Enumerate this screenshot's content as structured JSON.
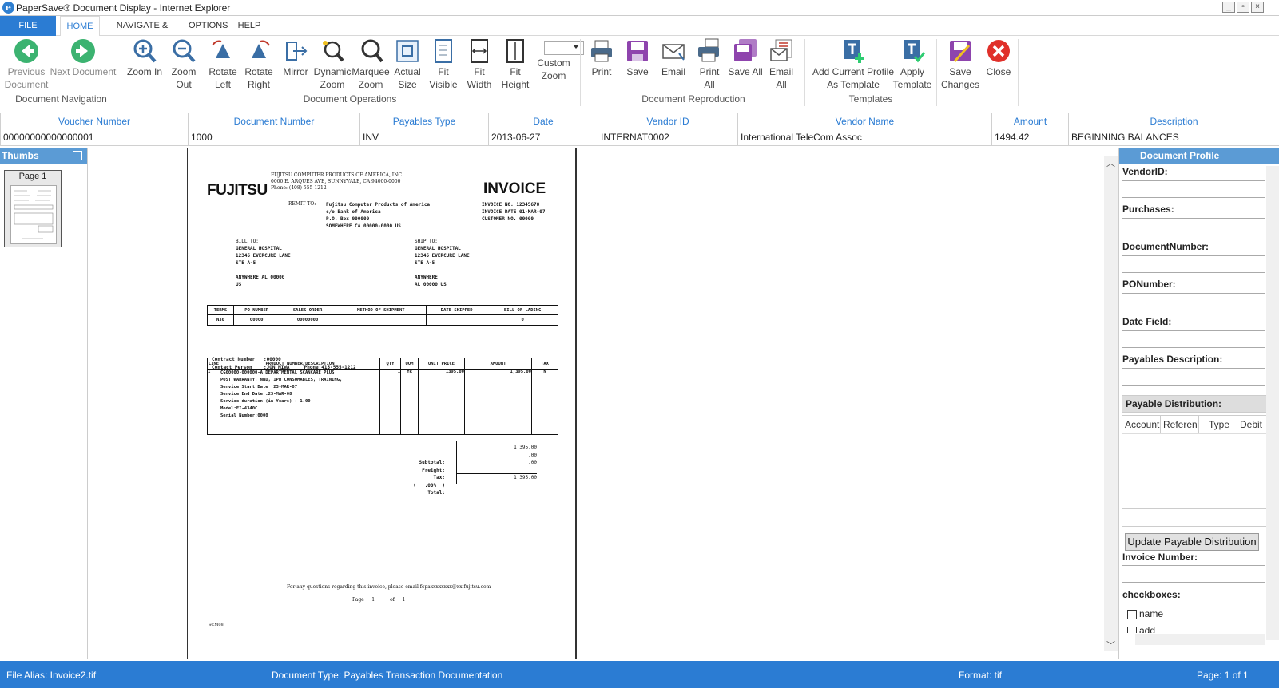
{
  "window": {
    "title": "PaperSave® Document Display - Internet Explorer"
  },
  "menu": {
    "file": "FILE",
    "home": "HOME",
    "navigate_edit": "NAVIGATE & EDIT",
    "options": "OPTIONS",
    "help": "HELP"
  },
  "ribbon": {
    "previous_document": [
      "Previous",
      "Document"
    ],
    "next_document": "Next Document",
    "zoom_in": "Zoom In",
    "zoom_out": "Zoom Out",
    "rotate_left": [
      "Rotate",
      "Left"
    ],
    "rotate_right": [
      "Rotate",
      "Right"
    ],
    "mirror": "Mirror",
    "dynamic_zoom": [
      "Dynamic",
      "Zoom"
    ],
    "marquee_zoom": [
      "Marquee",
      "Zoom"
    ],
    "actual_size": [
      "Actual",
      "Size"
    ],
    "fit_visible": [
      "Fit",
      "Visible"
    ],
    "fit_width": [
      "Fit",
      "Width"
    ],
    "fit_height": [
      "Fit",
      "Height"
    ],
    "custom_zoom": [
      "Custom",
      "Zoom"
    ],
    "print": "Print",
    "save": "Save",
    "email": "Email",
    "print_all": [
      "Print",
      "All"
    ],
    "save_all": "Save All",
    "email_all": [
      "Email",
      "All"
    ],
    "add_current_profile": [
      "Add Current Profile",
      "As Template"
    ],
    "apply_template": [
      "Apply",
      "Template"
    ],
    "save_changes": [
      "Save",
      "Changes"
    ],
    "close": "Close",
    "groups": {
      "navigation": "Document Navigation",
      "operations": "Document Operations",
      "reproduction": "Document Reproduction",
      "templates": "Templates"
    }
  },
  "grid": {
    "columns": [
      "Voucher Number",
      "Document Number",
      "Payables Type",
      "Date",
      "Vendor ID",
      "Vendor Name",
      "Amount",
      "Description"
    ],
    "row": [
      "00000000000000001",
      "1000",
      "INV",
      "2013-06-27",
      "INTERNAT0002",
      "International TeleCom Assoc",
      "1494.42",
      "BEGINNING BALANCES"
    ]
  },
  "thumbs": {
    "header": "Thumbs",
    "page_label": "Page 1"
  },
  "invoice": {
    "logo": "FUJITSU",
    "company": [
      "FUJITSU COMPUTER PRODUCTS OF AMERICA, INC.",
      "0000 E. ARQUES AVE, SUNNYVALE, CA 94000-0000",
      "Phone: (408) 555-1212"
    ],
    "title": "INVOICE",
    "remit_label": "REMIT TO:",
    "remit": [
      "Fujitsu Computer Products of America",
      "c/o Bank of America",
      "P.O. Box 000000",
      "SOMEWHERE CA 00000-0000 US"
    ],
    "meta": [
      "INVOICE NO. 12345678",
      "INVOICE DATE 01-MAR-07",
      "CUSTOMER NO. 00000"
    ],
    "bill_label": "BILL TO:",
    "bill": [
      "GENERAL HOSPITAL",
      "12345 EVERCURE LANE",
      "STE A-5",
      "",
      "ANYWHERE AL 00000",
      "US"
    ],
    "ship_label": "SHIP TO:",
    "ship": [
      "GENERAL HOSPITAL",
      "12345 EVERCURE LANE",
      "STE A-5",
      "",
      "ANYWHERE",
      "AL 00000 US"
    ],
    "terms_headers": [
      "TERMS",
      "PO NUMBER",
      "SALES ORDER",
      "METHOD OF SHIPMENT",
      "DATE SHIPPED",
      "BILL OF LADING"
    ],
    "terms_values": [
      "N30",
      "00000",
      "00000000",
      "",
      "",
      "0"
    ],
    "contract": [
      "Contract Number   :00000",
      "Contact Person    :JON MIWA     Phone:415-555-1212"
    ],
    "line_headers": [
      "LINE",
      "PRODUCT NUMBER/DESCRIPTION",
      "QTY",
      "UOM",
      "UNIT PRICE",
      "AMOUNT",
      "TAX"
    ],
    "line": {
      "no": "1",
      "desc": [
        "CG00000-000000-A DEPARTMENTAL SCANCARE PLUS",
        "POST WARRANTY, NBD, 1PM CONSUMABLES, TRAINING,",
        "Service Start Date :23-MAR-07",
        "Service End Date :23-MAR-08",
        "Service duration (in Years) : 1.00",
        "Model:FI-4340C",
        "Serial Number:0000"
      ],
      "qty": "1",
      "uom": "YR",
      "price": "1395.00",
      "amount": "1,395.00",
      "tax": "N"
    },
    "totals_labels": [
      "Subtotal:",
      "Freight:",
      "Tax:",
      "(   .00%  )",
      "Total:"
    ],
    "totals_values": [
      "1,395.00",
      ".00",
      ".00",
      "",
      "1,395.00"
    ],
    "footer": "For any questions regarding this invoice, please email fcpaxxxxxxxx@xx.fujitsu.com",
    "page": "Page     1          of     1",
    "code": "SCM08"
  },
  "profile": {
    "header": "Document Profile",
    "fields": [
      "VendorID:",
      "Purchases:",
      "DocumentNumber:",
      "PONumber:",
      "Date Field:",
      "Payables Description:"
    ],
    "payable_distribution": "Payable Distribution:",
    "pd_columns": [
      "Account",
      "Referenc",
      "Type",
      "Debit"
    ],
    "update_button": "Update Payable Distribution",
    "invoice_number": "Invoice Number:",
    "checkboxes_label": "checkboxes:",
    "checkboxes": [
      "name",
      "add"
    ]
  },
  "status": {
    "file_alias": "File Alias: Invoice2.tif",
    "doc_type": "Document Type: Payables Transaction Documentation",
    "format": "Format: tif",
    "page": "Page: 1 of 1"
  }
}
